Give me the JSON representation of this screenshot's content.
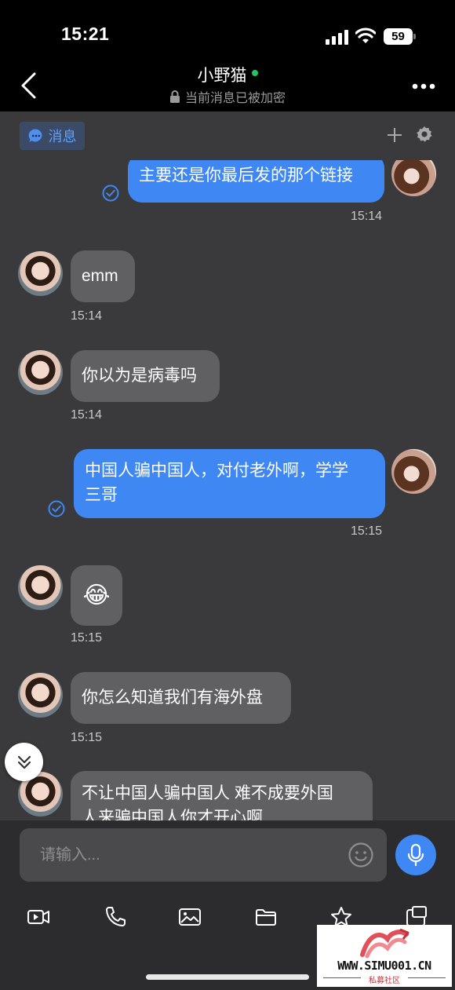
{
  "status_bar": {
    "time": "15:21",
    "battery": "59"
  },
  "header": {
    "contact_name": "小野猫",
    "encryption_notice": "当前消息已被加密"
  },
  "tabs": {
    "messages_label": "消息"
  },
  "messages": [
    {
      "from": "me",
      "text": "主要还是你最后发的那个链接",
      "time": "15:14",
      "read": true
    },
    {
      "from": "her",
      "text": "emm",
      "time": "15:14"
    },
    {
      "from": "her",
      "text": "你以为是病毒吗",
      "time": "15:14"
    },
    {
      "from": "me",
      "text_line1": "中国人骗中国人，对付老外啊，学学",
      "text_line2": "三哥",
      "time": "15:15",
      "read": true
    },
    {
      "from": "her",
      "text": "😂",
      "time": "15:15"
    },
    {
      "from": "her",
      "text": "你怎么知道我们有海外盘",
      "time": "15:15"
    },
    {
      "from": "her",
      "text_line1": "不让中国人骗中国人  难不成要外国",
      "text_line2": "人来骗中国人你才开心啊"
    }
  ],
  "input": {
    "placeholder": "请输入..."
  },
  "toolbar": [
    "video-icon",
    "phone-icon",
    "image-icon",
    "folder-icon",
    "star-icon",
    "screenshot-search-icon"
  ],
  "watermark": {
    "url": "WWW.SIMU001.CN",
    "subtitle": "私募社区"
  },
  "colors": {
    "accent": "#3f87f2",
    "online": "#22c55e",
    "bubble_in": "#606062",
    "chat_bg": "#3a3a3c"
  }
}
